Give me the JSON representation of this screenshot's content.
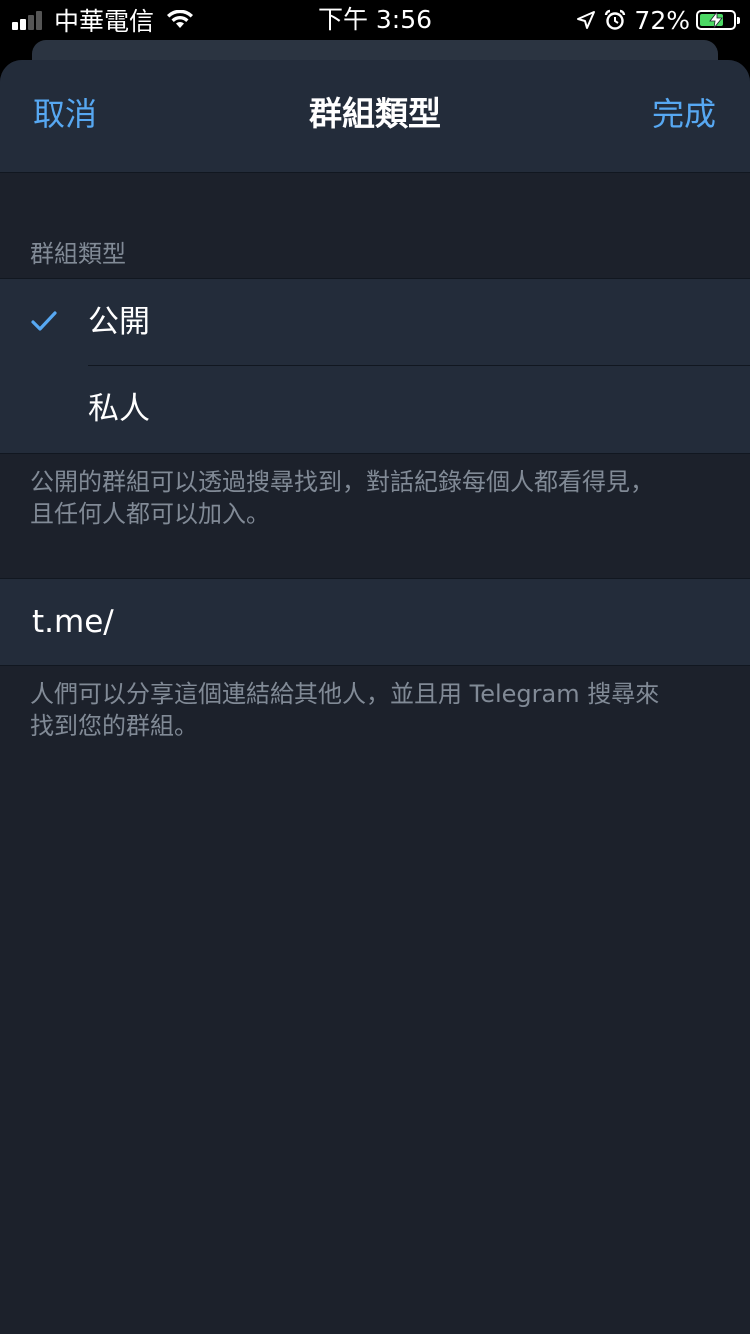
{
  "status_bar": {
    "carrier": "中華電信",
    "time": "下午 3:56",
    "battery_percent": "72%",
    "battery_level": 0.72
  },
  "nav": {
    "cancel": "取消",
    "title": "群組類型",
    "done": "完成"
  },
  "section": {
    "header": "群組類型",
    "options": [
      {
        "label": "公開",
        "selected": true
      },
      {
        "label": "私人",
        "selected": false
      }
    ],
    "footer_line1": "公開的群組可以透過搜尋找到，對話紀錄每個人都看得見，",
    "footer_line2": "且任何人都可以加入。"
  },
  "link": {
    "prefix": "t.me/",
    "value": "",
    "footer_line1": "人們可以分享這個連結給其他人，並且用 Telegram 搜尋來",
    "footer_line2": "找到您的群組。"
  },
  "colors": {
    "accent": "#57a8f2",
    "background": "#1c212b",
    "cell": "#232c3a",
    "secondary_text": "#818a96"
  }
}
